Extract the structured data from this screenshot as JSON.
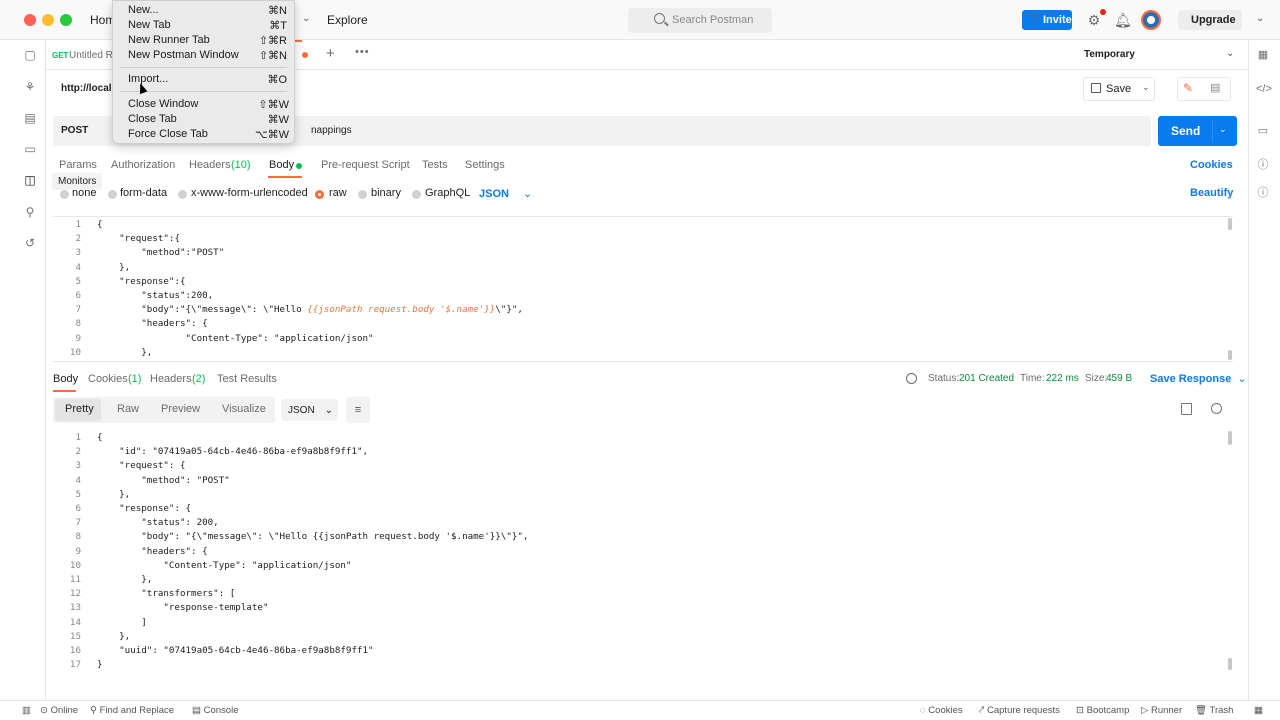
{
  "header": {
    "home": "Hom",
    "explore": "Explore",
    "search_placeholder": "Search Postman",
    "invite": "Invite",
    "upgrade": "Upgrade"
  },
  "tabs": {
    "method": "GET",
    "title": "Untitled Re",
    "environment": "Temporary"
  },
  "sidebar": {
    "tooltip": "Monitors"
  },
  "request": {
    "url_label": "http://local",
    "method": "POST",
    "url_tail": "nappings",
    "save": "Save",
    "send": "Send",
    "tabs": [
      "Params",
      "Authorization",
      "Headers",
      "(10)",
      "Body",
      "Pre-request Script",
      "Tests",
      "Settings"
    ],
    "cookies": "Cookies",
    "body_types": [
      "none",
      "form-data",
      "x-www-form-urlencoded",
      "raw",
      "binary",
      "GraphQL"
    ],
    "format": "JSON",
    "beautify": "Beautify",
    "code_lines": [
      "{",
      "    \"request\":{",
      "        \"method\":\"POST\"",
      "    },",
      "    \"response\":{",
      "        \"status\":200,",
      "        \"body\":\"{\\\"message\\\": \\\"Hello ",
      "        \"headers\": {",
      "                \"Content-Type\": \"application/json\"",
      "        },"
    ],
    "body_template": "{{jsonPath request.body '$.name'}}",
    "body_tail": "\\\"}\","
  },
  "response": {
    "tabs": [
      "Body",
      "Cookies",
      "(1)",
      "Headers",
      "(2)",
      "Test Results"
    ],
    "status_label": "Status:",
    "status_value": "201 Created",
    "time_label": "Time:",
    "time_value": "222 ms",
    "size_label": "Size:",
    "size_value": "459 B",
    "save_response": "Save Response",
    "views": [
      "Pretty",
      "Raw",
      "Preview",
      "Visualize"
    ],
    "format": "JSON",
    "code_lines": [
      "{",
      "    \"id\": \"07419a05-64cb-4e46-86ba-ef9a8b8f9ff1\",",
      "    \"request\": {",
      "        \"method\": \"POST\"",
      "    },",
      "    \"response\": {",
      "        \"status\": 200,",
      "        \"body\": \"{\\\"message\\\": \\\"Hello {{jsonPath request.body '$.name'}}\\\"}\",",
      "        \"headers\": {",
      "            \"Content-Type\": \"application/json\"",
      "        },",
      "        \"transformers\": [",
      "            \"response-template\"",
      "        ]",
      "    },",
      "    \"uuid\": \"07419a05-64cb-4e46-86ba-ef9a8b8f9ff1\"",
      "}"
    ]
  },
  "statusbar": {
    "online": "Online",
    "find_replace": "Find and Replace",
    "console": "Console",
    "cookies": "Cookies",
    "capture": "Capture requests",
    "bootcamp": "Bootcamp",
    "runner": "Runner",
    "trash": "Trash"
  },
  "file_menu": {
    "items": [
      {
        "label": "New...",
        "shortcut": "⌘N"
      },
      {
        "label": "New Tab",
        "shortcut": "⌘T"
      },
      {
        "label": "New Runner Tab",
        "shortcut": "⇧⌘R"
      },
      {
        "label": "New Postman Window",
        "shortcut": "⇧⌘N"
      },
      {
        "label": "Import...",
        "shortcut": "⌘O"
      },
      {
        "label": "Close Window",
        "shortcut": "⇧⌘W"
      },
      {
        "label": "Close Tab",
        "shortcut": "⌘W"
      },
      {
        "label": "Force Close Tab",
        "shortcut": "⌥⌘W"
      }
    ]
  },
  "colors": {
    "accent": "#ff6c37",
    "primary": "#097bed",
    "success": "#0cbb52"
  }
}
